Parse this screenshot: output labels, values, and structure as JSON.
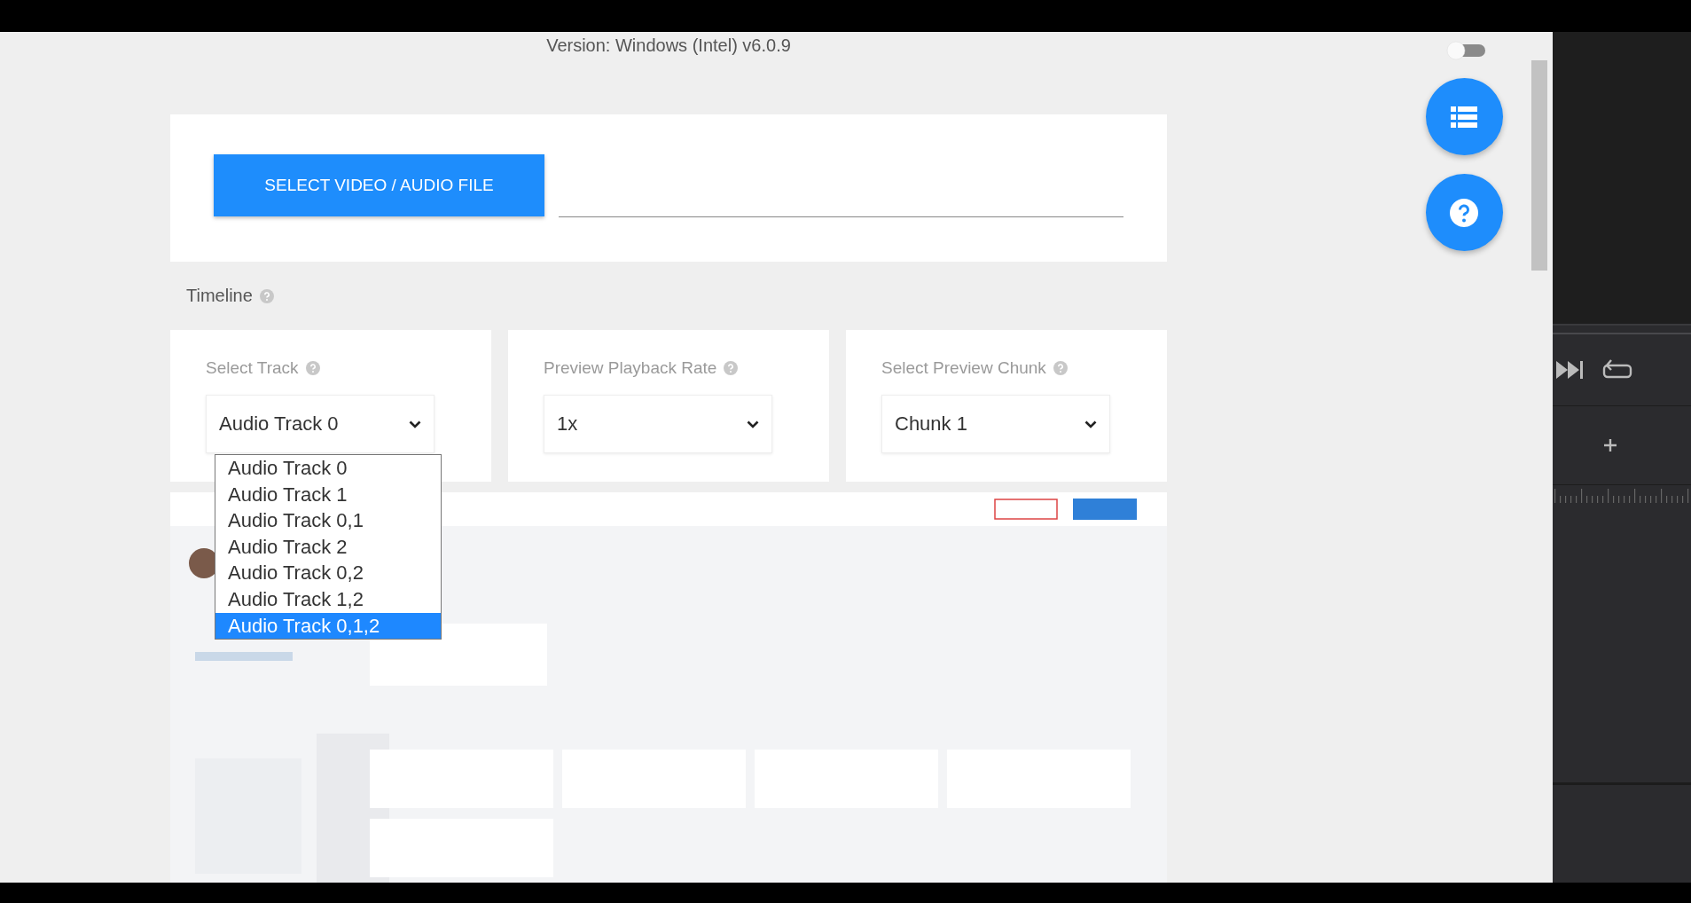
{
  "version": "Version: Windows (Intel) v6.0.9",
  "dark_mode_toggle": {
    "on": false
  },
  "file_picker": {
    "button": "SELECT VIDEO / AUDIO FILE"
  },
  "timeline": {
    "label": "Timeline"
  },
  "controls": [
    {
      "label": "Select Track",
      "value": "Audio Track 0"
    },
    {
      "label": "Preview Playback Rate",
      "value": "1x"
    },
    {
      "label": "Select Preview Chunk",
      "value": "Chunk 1"
    }
  ],
  "track_menu": {
    "options": [
      {
        "label": "Audio Track 0",
        "selected": false
      },
      {
        "label": "Audio Track 1",
        "selected": false
      },
      {
        "label": "Audio Track 0,1",
        "selected": false
      },
      {
        "label": "Audio Track 2",
        "selected": false
      },
      {
        "label": "Audio Track 0,2",
        "selected": false
      },
      {
        "label": "Audio Track 1,2",
        "selected": false
      },
      {
        "label": "Audio Track 0,1,2",
        "selected": true
      }
    ]
  }
}
